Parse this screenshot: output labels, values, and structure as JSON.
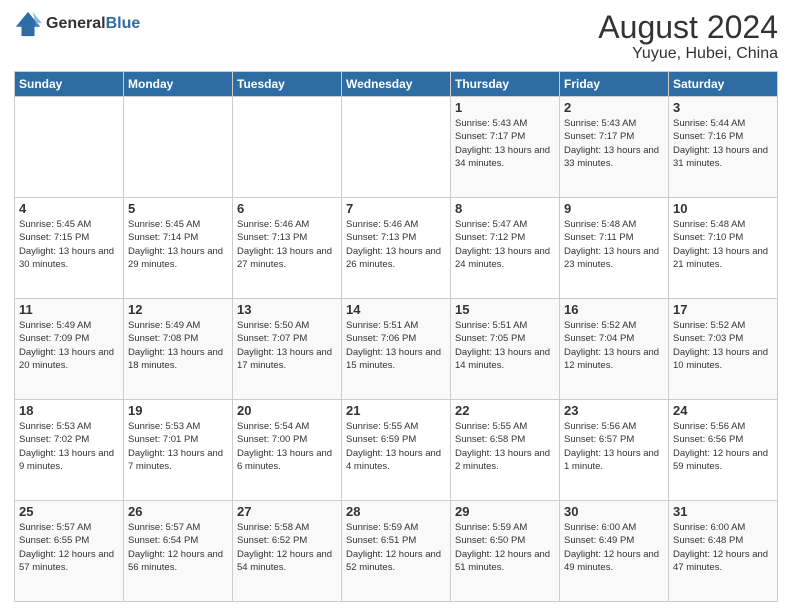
{
  "logo": {
    "line1": "General",
    "line2": "Blue"
  },
  "title": "August 2024",
  "subtitle": "Yuyue, Hubei, China",
  "days_of_week": [
    "Sunday",
    "Monday",
    "Tuesday",
    "Wednesday",
    "Thursday",
    "Friday",
    "Saturday"
  ],
  "weeks": [
    [
      {
        "day": "",
        "info": ""
      },
      {
        "day": "",
        "info": ""
      },
      {
        "day": "",
        "info": ""
      },
      {
        "day": "",
        "info": ""
      },
      {
        "day": "1",
        "info": "Sunrise: 5:43 AM\nSunset: 7:17 PM\nDaylight: 13 hours\nand 34 minutes."
      },
      {
        "day": "2",
        "info": "Sunrise: 5:43 AM\nSunset: 7:17 PM\nDaylight: 13 hours\nand 33 minutes."
      },
      {
        "day": "3",
        "info": "Sunrise: 5:44 AM\nSunset: 7:16 PM\nDaylight: 13 hours\nand 31 minutes."
      }
    ],
    [
      {
        "day": "4",
        "info": "Sunrise: 5:45 AM\nSunset: 7:15 PM\nDaylight: 13 hours\nand 30 minutes."
      },
      {
        "day": "5",
        "info": "Sunrise: 5:45 AM\nSunset: 7:14 PM\nDaylight: 13 hours\nand 29 minutes."
      },
      {
        "day": "6",
        "info": "Sunrise: 5:46 AM\nSunset: 7:13 PM\nDaylight: 13 hours\nand 27 minutes."
      },
      {
        "day": "7",
        "info": "Sunrise: 5:46 AM\nSunset: 7:13 PM\nDaylight: 13 hours\nand 26 minutes."
      },
      {
        "day": "8",
        "info": "Sunrise: 5:47 AM\nSunset: 7:12 PM\nDaylight: 13 hours\nand 24 minutes."
      },
      {
        "day": "9",
        "info": "Sunrise: 5:48 AM\nSunset: 7:11 PM\nDaylight: 13 hours\nand 23 minutes."
      },
      {
        "day": "10",
        "info": "Sunrise: 5:48 AM\nSunset: 7:10 PM\nDaylight: 13 hours\nand 21 minutes."
      }
    ],
    [
      {
        "day": "11",
        "info": "Sunrise: 5:49 AM\nSunset: 7:09 PM\nDaylight: 13 hours\nand 20 minutes."
      },
      {
        "day": "12",
        "info": "Sunrise: 5:49 AM\nSunset: 7:08 PM\nDaylight: 13 hours\nand 18 minutes."
      },
      {
        "day": "13",
        "info": "Sunrise: 5:50 AM\nSunset: 7:07 PM\nDaylight: 13 hours\nand 17 minutes."
      },
      {
        "day": "14",
        "info": "Sunrise: 5:51 AM\nSunset: 7:06 PM\nDaylight: 13 hours\nand 15 minutes."
      },
      {
        "day": "15",
        "info": "Sunrise: 5:51 AM\nSunset: 7:05 PM\nDaylight: 13 hours\nand 14 minutes."
      },
      {
        "day": "16",
        "info": "Sunrise: 5:52 AM\nSunset: 7:04 PM\nDaylight: 13 hours\nand 12 minutes."
      },
      {
        "day": "17",
        "info": "Sunrise: 5:52 AM\nSunset: 7:03 PM\nDaylight: 13 hours\nand 10 minutes."
      }
    ],
    [
      {
        "day": "18",
        "info": "Sunrise: 5:53 AM\nSunset: 7:02 PM\nDaylight: 13 hours\nand 9 minutes."
      },
      {
        "day": "19",
        "info": "Sunrise: 5:53 AM\nSunset: 7:01 PM\nDaylight: 13 hours\nand 7 minutes."
      },
      {
        "day": "20",
        "info": "Sunrise: 5:54 AM\nSunset: 7:00 PM\nDaylight: 13 hours\nand 6 minutes."
      },
      {
        "day": "21",
        "info": "Sunrise: 5:55 AM\nSunset: 6:59 PM\nDaylight: 13 hours\nand 4 minutes."
      },
      {
        "day": "22",
        "info": "Sunrise: 5:55 AM\nSunset: 6:58 PM\nDaylight: 13 hours\nand 2 minutes."
      },
      {
        "day": "23",
        "info": "Sunrise: 5:56 AM\nSunset: 6:57 PM\nDaylight: 13 hours\nand 1 minute."
      },
      {
        "day": "24",
        "info": "Sunrise: 5:56 AM\nSunset: 6:56 PM\nDaylight: 12 hours\nand 59 minutes."
      }
    ],
    [
      {
        "day": "25",
        "info": "Sunrise: 5:57 AM\nSunset: 6:55 PM\nDaylight: 12 hours\nand 57 minutes."
      },
      {
        "day": "26",
        "info": "Sunrise: 5:57 AM\nSunset: 6:54 PM\nDaylight: 12 hours\nand 56 minutes."
      },
      {
        "day": "27",
        "info": "Sunrise: 5:58 AM\nSunset: 6:52 PM\nDaylight: 12 hours\nand 54 minutes."
      },
      {
        "day": "28",
        "info": "Sunrise: 5:59 AM\nSunset: 6:51 PM\nDaylight: 12 hours\nand 52 minutes."
      },
      {
        "day": "29",
        "info": "Sunrise: 5:59 AM\nSunset: 6:50 PM\nDaylight: 12 hours\nand 51 minutes."
      },
      {
        "day": "30",
        "info": "Sunrise: 6:00 AM\nSunset: 6:49 PM\nDaylight: 12 hours\nand 49 minutes."
      },
      {
        "day": "31",
        "info": "Sunrise: 6:00 AM\nSunset: 6:48 PM\nDaylight: 12 hours\nand 47 minutes."
      }
    ]
  ]
}
